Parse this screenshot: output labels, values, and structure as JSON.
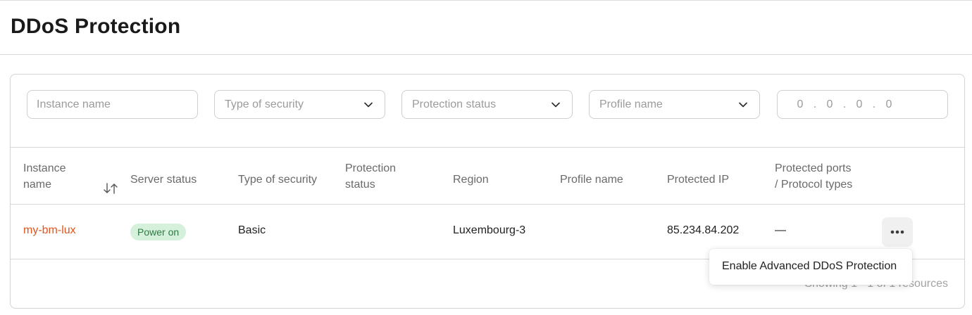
{
  "page": {
    "title": "DDoS Protection"
  },
  "filters": {
    "instance_name_placeholder": "Instance name",
    "type_of_security_placeholder": "Type of security",
    "protection_status_placeholder": "Protection status",
    "profile_name_placeholder": "Profile name",
    "ip_segments": [
      "0",
      "0",
      "0",
      "0"
    ],
    "ip_separator": "."
  },
  "table": {
    "columns": {
      "instance_name": [
        "Instance",
        "name"
      ],
      "server_status": "Server status",
      "type_of_security": "Type of security",
      "protection_status": [
        "Protection",
        "status"
      ],
      "region": "Region",
      "profile_name": "Profile name",
      "protected_ip": "Protected IP",
      "protected_ports": [
        "Protected ports",
        "/ Protocol types"
      ]
    },
    "rows": [
      {
        "instance_name": "my-bm-lux",
        "server_status": "Power on",
        "type_of_security": "Basic",
        "protection_status": "",
        "region": "Luxembourg-3",
        "profile_name": "",
        "protected_ip": "85.234.84.202",
        "protected_ports": "—"
      }
    ]
  },
  "footer": {
    "showing_text": "Showing 1 - 1 of 1 resources"
  },
  "context_menu": {
    "items": [
      "Enable Advanced DDoS Protection"
    ]
  },
  "colors": {
    "link": "#e2541b",
    "badge_bg": "#d5f1db",
    "badge_text": "#2f7a42"
  },
  "icons": {
    "sort": "sort-arrows-icon",
    "dropdown": "chevron-down-icon",
    "more": "more-horizontal-icon"
  }
}
